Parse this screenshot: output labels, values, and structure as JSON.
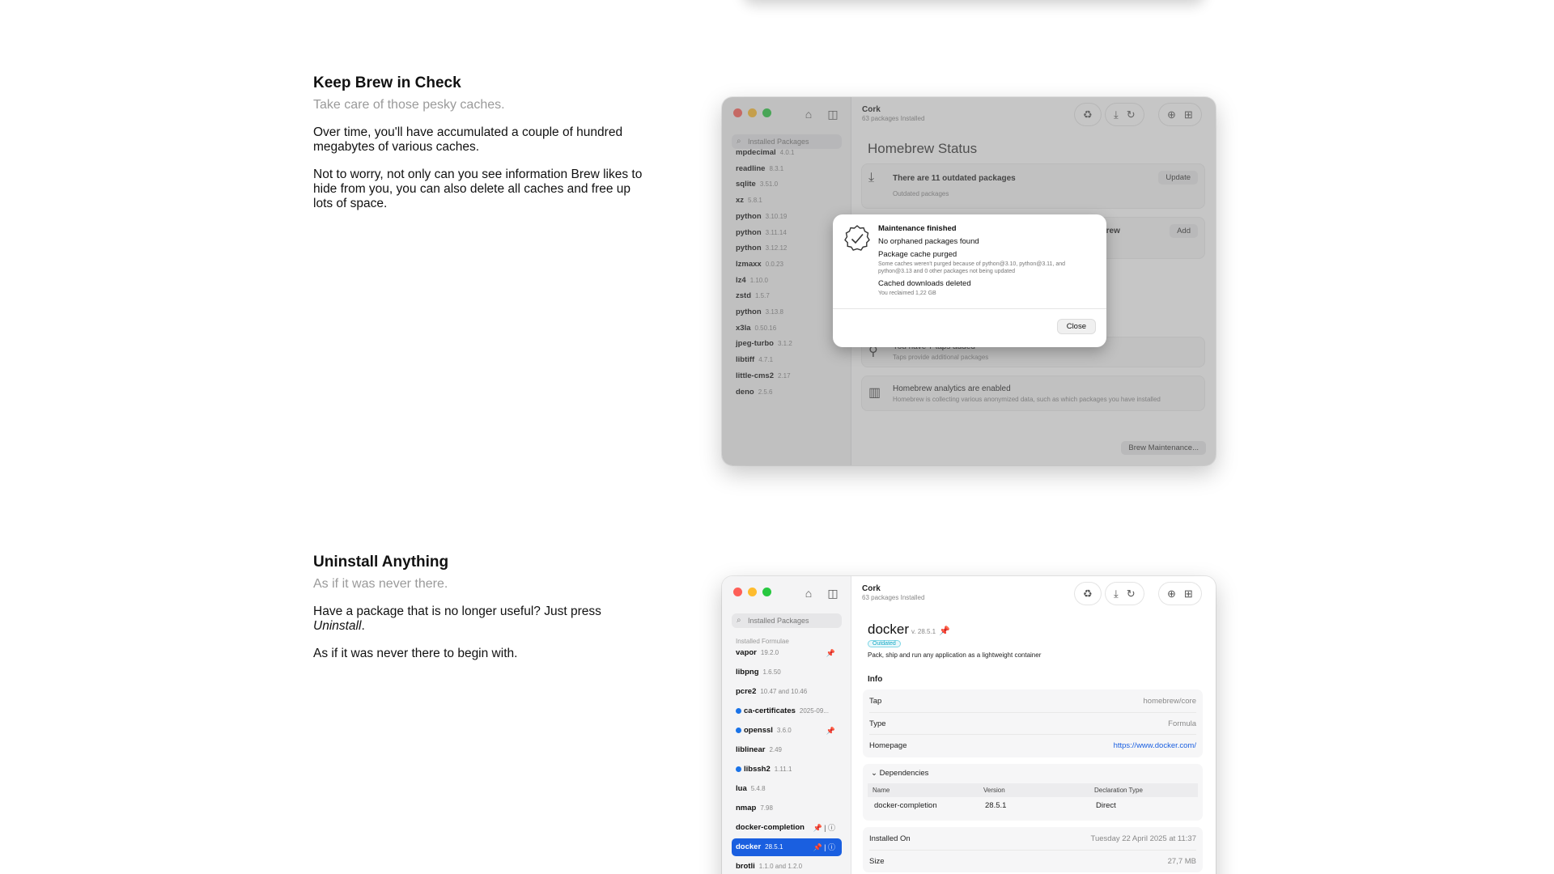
{
  "features": [
    {
      "title": "Keep Brew in Check",
      "subtitle": "Take care of those pesky caches.",
      "p1": "Over time, you'll have accumulated a couple of hundred megabytes of various caches.",
      "p2": "Not to worry, not only can you see information Brew likes to hide from you, you can also delete all caches and free up lots of space."
    },
    {
      "title": "Uninstall Anything",
      "subtitle": "As if it was never there.",
      "p1_pre": "Have a package that is no longer useful? Just press ",
      "p1_em": "Uninstall",
      "p1_post": ".",
      "p2": "As if it was never there to begin with."
    }
  ],
  "app": {
    "title": "Cork",
    "subtitle": "63 packages Installed",
    "search_placeholder": "Installed Packages"
  },
  "window1": {
    "packages": [
      {
        "name": "mpdecimal",
        "version": "4.0.1"
      },
      {
        "name": "readline",
        "version": "8.3.1"
      },
      {
        "name": "sqlite",
        "version": "3.51.0"
      },
      {
        "name": "xz",
        "version": "5.8.1"
      },
      {
        "name": "python",
        "version": "3.10.19"
      },
      {
        "name": "python",
        "version": "3.11.14"
      },
      {
        "name": "python",
        "version": "3.12.12"
      },
      {
        "name": "lzmaxx",
        "version": "0.0.23"
      },
      {
        "name": "lz4",
        "version": "1.10.0"
      },
      {
        "name": "zstd",
        "version": "1.5.7"
      },
      {
        "name": "python",
        "version": "3.13.8"
      },
      {
        "name": "x3la",
        "version": "0.50.16"
      },
      {
        "name": "jpeg-turbo",
        "version": "3.1.2"
      },
      {
        "name": "libtiff",
        "version": "4.7.1"
      },
      {
        "name": "little-cms2",
        "version": "2.17"
      },
      {
        "name": "deno",
        "version": "2.5.6"
      }
    ],
    "status_title": "Homebrew Status",
    "outdated_title": "There are 11 outdated packages",
    "outdated_sub": "Outdated packages",
    "update_label": "Update",
    "brew_fragment": "ebrew",
    "add_label": "Add",
    "taps_title": "You have 7 taps added",
    "taps_sub": "Taps provide additional packages",
    "analytics_title": "Homebrew analytics are enabled",
    "analytics_sub": "Homebrew is collecting various anonymized data, such as which packages you have installed",
    "maintenance_label": "Brew Maintenance...",
    "dialog": {
      "title": "Maintenance finished",
      "line1": "No orphaned packages found",
      "line2": "Package cache purged",
      "line2_sub": "Some caches weren't purged because of python@3.10, python@3.11, and python@3.13 and 0 other packages not being updated",
      "line3": "Cached downloads deleted",
      "line3_sub": "You reclaimed 1,22 GB",
      "close_label": "Close"
    }
  },
  "window2": {
    "section_label": "Installed Formulae",
    "packages": [
      {
        "name": "vapor",
        "version": "19.2.0",
        "pin": "📌",
        "dot": false
      },
      {
        "name": "libpng",
        "version": "1.6.50",
        "pin": "",
        "dot": false
      },
      {
        "name": "pcre2",
        "version": "10.47 and 10.46",
        "pin": "",
        "dot": false
      },
      {
        "name": "ca-certificates",
        "version": "2025-09...",
        "pin": "",
        "dot": true
      },
      {
        "name": "openssl",
        "version": "3.6.0",
        "pin": "📌",
        "dot": true
      },
      {
        "name": "liblinear",
        "version": "2.49",
        "pin": "",
        "dot": false
      },
      {
        "name": "libssh2",
        "version": "1.11.1",
        "pin": "",
        "dot": true
      },
      {
        "name": "lua",
        "version": "5.4.8",
        "pin": "",
        "dot": false
      },
      {
        "name": "nmap",
        "version": "7.98",
        "pin": "",
        "dot": false
      },
      {
        "name": "docker-completion",
        "version": "",
        "pin": "📌 | ⓘ",
        "dot": false
      },
      {
        "name": "docker",
        "version": "28.5.1",
        "pin": "📌 | ⓘ",
        "dot": false
      },
      {
        "name": "brotli",
        "version": "1.1.0 and 1.2.0",
        "pin": "",
        "dot": false
      }
    ],
    "pkg_name": "docker",
    "pkg_version": "v. 28.5.1",
    "outdated_badge": "Outdated",
    "description": "Pack, ship and run any application as a lightweight container",
    "info_heading": "Info",
    "tap_label": "Tap",
    "tap_value": "homebrew/core",
    "type_label": "Type",
    "type_value": "Formula",
    "homepage_label": "Homepage",
    "homepage_value": "https://www.docker.com/",
    "deps_label": "Dependencies",
    "dep_cols": [
      "Name",
      "Version",
      "Declaration Type"
    ],
    "dep_rows": [
      [
        "docker-completion",
        "28.5.1",
        "Direct"
      ]
    ],
    "installed_on_label": "Installed On",
    "installed_on_value": "Tuesday 22 April 2025 at 11:37",
    "size_label": "Size",
    "size_value": "27,7 MB"
  }
}
